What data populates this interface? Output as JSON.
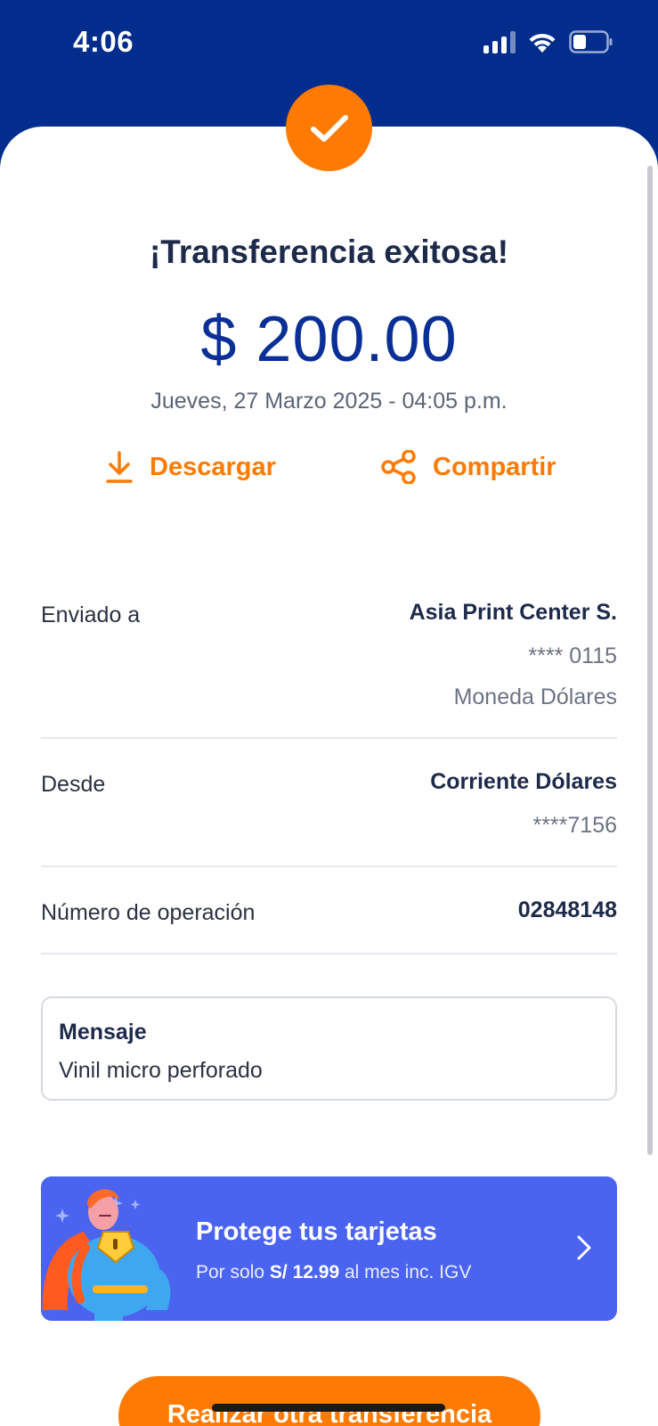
{
  "status_bar": {
    "time": "4:06"
  },
  "header": {
    "title": "¡Transferencia exitosa!"
  },
  "amount": {
    "value": "$ 200.00",
    "datetime": "Jueves, 27 Marzo 2025 - 04:05 p.m."
  },
  "actions": {
    "download_label": "Descargar",
    "share_label": "Compartir"
  },
  "details": {
    "sent_to": {
      "label": "Enviado a",
      "name": "Asia Print Center S.",
      "account": "**** 0115",
      "currency": "Moneda Dólares"
    },
    "from": {
      "label": "Desde",
      "account_type": "Corriente Dólares",
      "account": "****7156"
    },
    "operation": {
      "label": "Número de operación",
      "number": "02848148"
    }
  },
  "message": {
    "title": "Mensaje",
    "text": "Vinil micro perforado"
  },
  "promo": {
    "title": "Protege tus tarjetas",
    "prefix": "Por solo",
    "price": "S/ 12.99",
    "suffix": "al mes inc. IGV"
  },
  "cta": {
    "label": "Realizar otra transferencia"
  },
  "colors": {
    "brand_blue": "#022d8c",
    "accent_orange": "#ff7a00",
    "promo_blue": "#4a64f0"
  }
}
